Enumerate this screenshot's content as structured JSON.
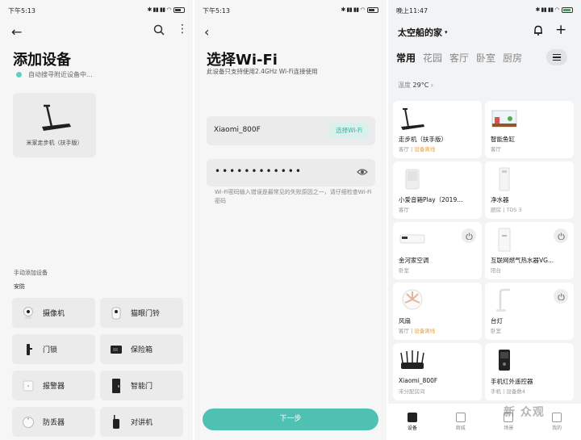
{
  "panel1": {
    "status_time": "下午5:13",
    "title": "添加设备",
    "scanning_text": "自动搜寻附近设备中...",
    "found_device": {
      "name": "米家走步机（扶手版）",
      "icon": "treadmill-icon"
    },
    "manual_add_title": "手动添加设备",
    "section_title": "安防",
    "categories": [
      {
        "label": "摄像机",
        "icon": "camera-icon"
      },
      {
        "label": "猫眼门铃",
        "icon": "doorbell-icon"
      },
      {
        "label": "门锁",
        "icon": "door-lock-icon"
      },
      {
        "label": "保险箱",
        "icon": "safe-icon"
      },
      {
        "label": "报警器",
        "icon": "alarm-icon"
      },
      {
        "label": "智能门",
        "icon": "smart-door-icon"
      },
      {
        "label": "防丢器",
        "icon": "tracker-icon"
      },
      {
        "label": "对讲机",
        "icon": "walkie-talkie-icon"
      }
    ]
  },
  "panel2": {
    "status_time": "下午5:13",
    "title": "选择Wi-Fi",
    "subtitle": "此设备只支持使用2.4GHz Wi-Fi连接使用",
    "wifi_name": "Xiaomi_800F",
    "choose_wifi_label": "选择Wi-Fi",
    "password_masked": "••••••••••••",
    "hint": "Wi-Fi密码输入错误是最常见的失败原因之一，请仔细检查Wi-Fi密码",
    "next_label": "下一步",
    "accent": "#4ec1b3"
  },
  "panel3": {
    "status_time": "晚上11:47",
    "home_name": "太空船的家",
    "rooms": [
      "常用",
      "花园",
      "客厅",
      "卧室",
      "厨房"
    ],
    "temp_label": "温度",
    "temp_value": "29°C",
    "devices": [
      {
        "name": "走步机（扶手版）",
        "room": "客厅",
        "status": "设备离线",
        "icon": "treadmill-icon",
        "power": false
      },
      {
        "name": "智能鱼缸",
        "room": "客厅",
        "status": "",
        "icon": "aquarium-icon",
        "power": false
      },
      {
        "name": "小爱音箱Play（2019...",
        "room": "客厅",
        "status": "",
        "icon": "speaker-icon",
        "power": false
      },
      {
        "name": "净水器",
        "room": "厨房 | TDS 3",
        "status": "",
        "icon": "water-purifier-icon",
        "power": false
      },
      {
        "name": "金河家空调",
        "room": "卧室",
        "status": "",
        "icon": "air-conditioner-icon",
        "power": true
      },
      {
        "name": "互联网燃气热水器VG...",
        "room": "阳台",
        "status": "",
        "icon": "water-heater-icon",
        "power": true
      },
      {
        "name": "风扇",
        "room": "客厅",
        "status": "设备离线",
        "icon": "fan-icon",
        "power": false
      },
      {
        "name": "台灯",
        "room": "卧室",
        "status": "",
        "icon": "desk-lamp-icon",
        "power": true
      },
      {
        "name": "Xiaomi_800F",
        "room": "未分配房间",
        "status": "",
        "icon": "router-icon",
        "power": false
      },
      {
        "name": "手机红外遥控器",
        "room": "手机 | 设备数4",
        "status": "",
        "icon": "ir-remote-icon",
        "power": false
      }
    ],
    "nav": [
      {
        "label": "设备",
        "active": true
      },
      {
        "label": "商城",
        "active": false
      },
      {
        "label": "场景",
        "active": false
      },
      {
        "label": "我的",
        "active": false
      }
    ],
    "watermark": "新 众观"
  }
}
